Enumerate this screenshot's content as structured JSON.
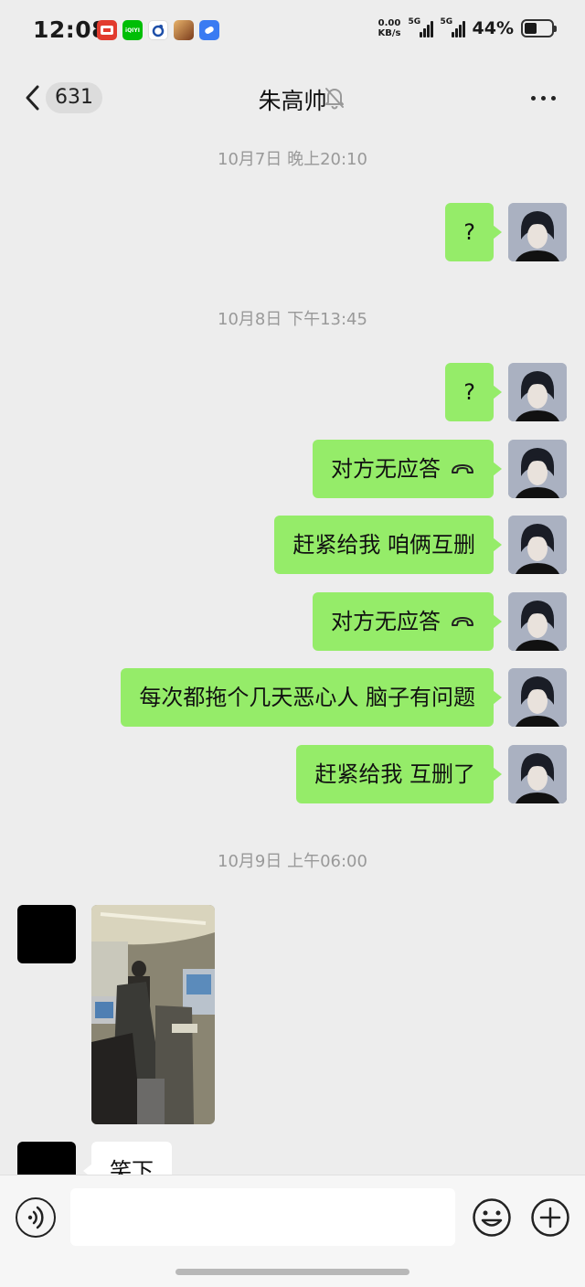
{
  "status_bar": {
    "time": "12:08",
    "net_speed_value": "0.00",
    "net_speed_unit": "KB/s",
    "signal1_label": "5G",
    "signal2_label": "5G",
    "battery_percent": "44%",
    "battery_level": 0.44,
    "app_icons": [
      "jd-app-icon",
      "iqiyi-app-icon",
      "weibo-app-icon",
      "game-app-icon",
      "bubble-app-icon"
    ],
    "iqiyi_text": "iQIYI"
  },
  "header": {
    "unread_count": "631",
    "title": "朱高帅",
    "muted": true
  },
  "messages": [
    {
      "type": "time",
      "text": "10月7日 晚上20:10"
    },
    {
      "type": "text",
      "sender": "me",
      "text": "?"
    },
    {
      "type": "time",
      "text": "10月8日 下午13:45"
    },
    {
      "type": "text",
      "sender": "me",
      "text": "?"
    },
    {
      "type": "call",
      "sender": "me",
      "text": "对方无应答"
    },
    {
      "type": "text",
      "sender": "me",
      "text": "赶紧给我 咱俩互删"
    },
    {
      "type": "call",
      "sender": "me",
      "text": "对方无应答"
    },
    {
      "type": "text",
      "sender": "me",
      "text": "每次都拖个几天恶心人 脑子有问题"
    },
    {
      "type": "text",
      "sender": "me",
      "text": "赶紧给我 互删了"
    },
    {
      "type": "time",
      "text": "10月9日 上午06:00"
    },
    {
      "type": "image",
      "sender": "other",
      "content": "train-interior-photo"
    },
    {
      "type": "text",
      "sender": "other",
      "text": "笑下"
    }
  ],
  "input": {
    "value": "",
    "placeholder": ""
  },
  "colors": {
    "background": "#ededed",
    "my_bubble": "#95ec69",
    "other_bubble": "#ffffff",
    "timestamp": "#999999"
  }
}
